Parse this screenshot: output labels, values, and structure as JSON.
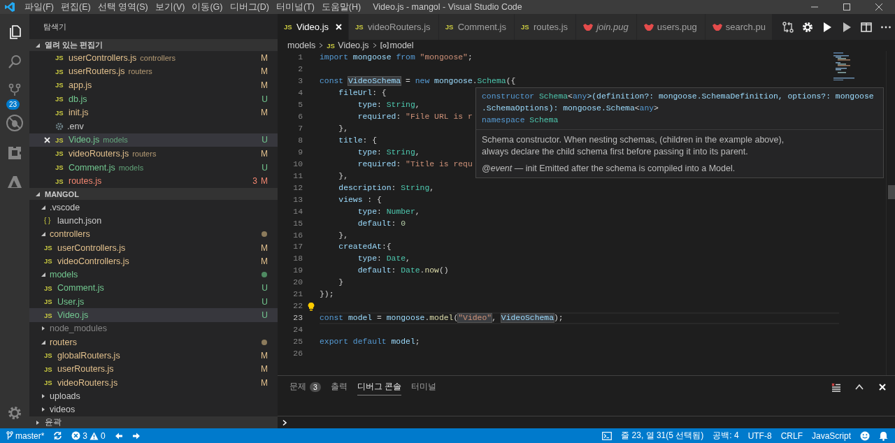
{
  "window": {
    "title": "Video.js - mangol - Visual Studio Code"
  },
  "menu": [
    "파일(F)",
    "편집(E)",
    "선택 영역(S)",
    "보기(V)",
    "이동(G)",
    "디버그(D)",
    "터미널(T)",
    "도움말(H)"
  ],
  "activity_bar": {
    "source_control_badge": "23"
  },
  "sidebar": {
    "title": "탐색기",
    "open_editors": {
      "title": "열려 있는 편집기",
      "expanded": true,
      "items": [
        {
          "name": "userControllers.js",
          "dir": "controllers",
          "kind": "js",
          "icon": "JS",
          "status": "M",
          "selected": false
        },
        {
          "name": "userRouters.js",
          "dir": "routers",
          "kind": "js",
          "icon": "JS",
          "status": "M",
          "selected": false
        },
        {
          "name": "app.js",
          "kind": "js",
          "icon": "JS",
          "status": "M",
          "selected": false
        },
        {
          "name": "db.js",
          "kind": "js",
          "icon": "JS",
          "status": "U",
          "selected": false
        },
        {
          "name": "init.js",
          "kind": "js",
          "icon": "JS",
          "status": "M",
          "selected": false
        },
        {
          "name": ".env",
          "kind": "config",
          "selected": false
        },
        {
          "name": "Video.js",
          "dir": "models",
          "kind": "js",
          "icon": "JS",
          "status": "U",
          "selected": true
        },
        {
          "name": "videoRouters.js",
          "dir": "routers",
          "kind": "js",
          "icon": "JS",
          "status": "M",
          "selected": false
        },
        {
          "name": "Comment.js",
          "dir": "models",
          "kind": "js",
          "icon": "JS",
          "status": "U",
          "selected": false
        },
        {
          "name": "routes.js",
          "kind": "js",
          "icon": "JS",
          "status": "M",
          "problems": "3",
          "selected": false
        }
      ]
    },
    "workspace": {
      "title": "MANGOL",
      "expanded": true,
      "items": [
        {
          "name": ".vscode",
          "kind": "folder",
          "expanded": true,
          "selected": false,
          "children": [
            {
              "name": "launch.json",
              "kind": "json",
              "icon": "{ }",
              "selected": false
            }
          ]
        },
        {
          "name": "controllers",
          "kind": "folder",
          "expanded": true,
          "color": "#8c7b5c",
          "selected": false,
          "children": [
            {
              "name": "userControllers.js",
              "kind": "js",
              "icon": "JS",
              "status": "M",
              "selected": false
            },
            {
              "name": "videoControllers.js",
              "kind": "js",
              "icon": "JS",
              "status": "M",
              "selected": false
            }
          ]
        },
        {
          "name": "models",
          "kind": "folder",
          "expanded": true,
          "color": "#4f8a62",
          "selected": false,
          "children": [
            {
              "name": "Comment.js",
              "kind": "js",
              "icon": "JS",
              "status": "U",
              "selected": false
            },
            {
              "name": "User.js",
              "kind": "js",
              "icon": "JS",
              "status": "U",
              "selected": false
            },
            {
              "name": "Video.js",
              "kind": "js",
              "icon": "JS",
              "status": "U",
              "selected": true
            }
          ]
        },
        {
          "name": "node_modules",
          "kind": "folder",
          "expanded": false,
          "ignored": true,
          "selected": false
        },
        {
          "name": "routers",
          "kind": "folder",
          "expanded": true,
          "color": "#8c7b5c",
          "selected": false,
          "children": [
            {
              "name": "globalRouters.js",
              "kind": "js",
              "icon": "JS",
              "status": "M",
              "selected": false
            },
            {
              "name": "userRouters.js",
              "kind": "js",
              "icon": "JS",
              "status": "M",
              "selected": false
            },
            {
              "name": "videoRouters.js",
              "kind": "js",
              "icon": "JS",
              "status": "M",
              "selected": false
            }
          ]
        },
        {
          "name": "uploads",
          "kind": "folder",
          "expanded": false,
          "selected": false
        },
        {
          "name": "videos",
          "kind": "folder",
          "expanded": false,
          "selected": false
        }
      ]
    },
    "outline": {
      "title": "윤곽",
      "expanded": false
    }
  },
  "editor_tabs": [
    {
      "label": "Video.js",
      "kind": "js",
      "icon": "JS",
      "selected": true,
      "preview": false
    },
    {
      "label": "videoRouters.js",
      "kind": "js",
      "icon": "JS",
      "selected": false,
      "preview": false
    },
    {
      "label": "Comment.js",
      "kind": "js",
      "icon": "JS",
      "selected": false,
      "preview": false
    },
    {
      "label": "routes.js",
      "kind": "js",
      "icon": "JS",
      "selected": false,
      "preview": false
    },
    {
      "label": "join.pug",
      "kind": "pug",
      "selected": false,
      "preview": true
    },
    {
      "label": "users.pug",
      "kind": "pug",
      "selected": false,
      "preview": false
    },
    {
      "label": "search.pu",
      "kind": "pug",
      "selected": false,
      "preview": false
    }
  ],
  "breadcrumbs": [
    {
      "label": "models",
      "kind": "folder"
    },
    {
      "label": "Video.js",
      "kind": "js",
      "icon": "JS"
    },
    {
      "label": "model",
      "kind": "symbol"
    }
  ],
  "code": [
    {
      "number": "1",
      "tokens": [
        {
          "text": "import",
          "kind": "kw"
        },
        {
          "text": " mongoose",
          "kind": "var"
        },
        {
          "text": " from",
          "kind": "kw"
        },
        {
          "text": " \"mongoose\"",
          "kind": "str"
        },
        {
          "text": ";",
          "kind": "p"
        }
      ]
    },
    {
      "number": "2"
    },
    {
      "number": "3",
      "tokens": [
        {
          "text": "const ",
          "kind": "kw"
        },
        {
          "text": "VideoSchema",
          "kind": "var",
          "highlighted": true
        },
        {
          "text": " =",
          "kind": "p"
        },
        {
          "text": " new",
          "kind": "kw"
        },
        {
          "text": " mongoose",
          "kind": "var"
        },
        {
          "text": ".",
          "kind": "p"
        },
        {
          "text": "Schema",
          "kind": "type"
        },
        {
          "text": "({",
          "kind": "p"
        }
      ]
    },
    {
      "number": "4",
      "tokens": [
        {
          "text": "    fileUrl",
          "kind": "prop"
        },
        {
          "text": ": {",
          "kind": "p"
        }
      ]
    },
    {
      "number": "5",
      "tokens": [
        {
          "text": "        type",
          "kind": "prop"
        },
        {
          "text": ":",
          "kind": "p"
        },
        {
          "text": " String",
          "kind": "type"
        },
        {
          "text": ",",
          "kind": "p"
        }
      ]
    },
    {
      "number": "6",
      "tokens": [
        {
          "text": "        required",
          "kind": "prop"
        },
        {
          "text": ":",
          "kind": "p"
        },
        {
          "text": " \"File URL is r",
          "kind": "str"
        }
      ]
    },
    {
      "number": "7",
      "tokens": [
        {
          "text": "    },",
          "kind": "p"
        }
      ]
    },
    {
      "number": "8",
      "tokens": [
        {
          "text": "    title",
          "kind": "prop"
        },
        {
          "text": ": {",
          "kind": "p"
        }
      ]
    },
    {
      "number": "9",
      "tokens": [
        {
          "text": "        type",
          "kind": "prop"
        },
        {
          "text": ":",
          "kind": "p"
        },
        {
          "text": " String",
          "kind": "type"
        },
        {
          "text": ",",
          "kind": "p"
        }
      ]
    },
    {
      "number": "10",
      "tokens": [
        {
          "text": "        required",
          "kind": "prop"
        },
        {
          "text": ":",
          "kind": "p"
        },
        {
          "text": " \"Title is requ",
          "kind": "str"
        }
      ]
    },
    {
      "number": "11",
      "tokens": [
        {
          "text": "    },",
          "kind": "p"
        }
      ]
    },
    {
      "number": "12",
      "tokens": [
        {
          "text": "    description",
          "kind": "prop"
        },
        {
          "text": ":",
          "kind": "p"
        },
        {
          "text": " String",
          "kind": "type"
        },
        {
          "text": ",",
          "kind": "p"
        }
      ]
    },
    {
      "number": "13",
      "tokens": [
        {
          "text": "    views",
          "kind": "prop"
        },
        {
          "text": " : {",
          "kind": "p"
        }
      ]
    },
    {
      "number": "14",
      "tokens": [
        {
          "text": "        type",
          "kind": "prop"
        },
        {
          "text": ":",
          "kind": "p"
        },
        {
          "text": " Number",
          "kind": "type"
        },
        {
          "text": ",",
          "kind": "p"
        }
      ]
    },
    {
      "number": "15",
      "tokens": [
        {
          "text": "        default",
          "kind": "prop"
        },
        {
          "text": ":",
          "kind": "p"
        },
        {
          "text": " 0",
          "kind": "num"
        }
      ]
    },
    {
      "number": "16",
      "tokens": [
        {
          "text": "    },",
          "kind": "p"
        }
      ]
    },
    {
      "number": "17",
      "tokens": [
        {
          "text": "    createdAt",
          "kind": "prop"
        },
        {
          "text": ":{",
          "kind": "p"
        }
      ]
    },
    {
      "number": "18",
      "tokens": [
        {
          "text": "        type",
          "kind": "prop"
        },
        {
          "text": ":",
          "kind": "p"
        },
        {
          "text": " Date",
          "kind": "type"
        },
        {
          "text": ",",
          "kind": "p"
        }
      ]
    },
    {
      "number": "19",
      "tokens": [
        {
          "text": "        default",
          "kind": "prop"
        },
        {
          "text": ":",
          "kind": "p"
        },
        {
          "text": " Date",
          "kind": "type"
        },
        {
          "text": ".",
          "kind": "p"
        },
        {
          "text": "now",
          "kind": "fn"
        },
        {
          "text": "()",
          "kind": "p"
        }
      ]
    },
    {
      "number": "20",
      "tokens": [
        {
          "text": "    }",
          "kind": "p"
        }
      ]
    },
    {
      "number": "21",
      "tokens": [
        {
          "text": "});",
          "kind": "p"
        }
      ]
    },
    {
      "number": "22",
      "lightbulb": true
    },
    {
      "number": "23",
      "tokens": [
        {
          "text": "const",
          "kind": "kw"
        },
        {
          "text": " model",
          "kind": "var"
        },
        {
          "text": " =",
          "kind": "p"
        },
        {
          "text": " mongoose",
          "kind": "var"
        },
        {
          "text": ".",
          "kind": "p"
        },
        {
          "text": "model",
          "kind": "fn"
        },
        {
          "text": "(",
          "kind": "p"
        },
        {
          "text": "\"Video\"",
          "kind": "str",
          "highlighted": true
        },
        {
          "text": ", ",
          "kind": "p"
        },
        {
          "text": "VideoSchema",
          "kind": "var",
          "highlighted": true
        },
        {
          "text": ");",
          "kind": "p"
        }
      ],
      "current": true
    },
    {
      "number": "24"
    },
    {
      "number": "25",
      "tokens": [
        {
          "text": "export",
          "kind": "kw"
        },
        {
          "text": " default",
          "kind": "kw"
        },
        {
          "text": " model",
          "kind": "var"
        },
        {
          "text": ";",
          "kind": "p"
        }
      ]
    },
    {
      "number": "26"
    }
  ],
  "hover": {
    "signature": [
      [
        {
          "text": "constructor",
          "kind": "kw"
        },
        {
          "text": " Schema",
          "kind": "type"
        },
        {
          "text": "<",
          "kind": "p"
        },
        {
          "text": "any",
          "kind": "kw"
        },
        {
          "text": ">(definition?: mongoose.SchemaDefinition, options?: mongoose",
          "kind": "sig"
        }
      ],
      [
        {
          "text": ".SchemaOptions): mongoose.Schema",
          "kind": "sig"
        },
        {
          "text": "<",
          "kind": "p"
        },
        {
          "text": "any",
          "kind": "kw"
        },
        {
          "text": ">",
          "kind": "p"
        }
      ],
      [
        {
          "text": "namespace",
          "kind": "kw"
        },
        {
          "text": " Schema",
          "kind": "type"
        }
      ]
    ],
    "doc": [
      "Schema constructor. When nesting schemas, (children in the example above),",
      "always declare the child schema first before passing it into its parent."
    ],
    "tag": "*@event* — init Emitted after the schema is compiled into a Model."
  },
  "panel": {
    "tabs": [
      {
        "label": "문제",
        "badge": "3",
        "selected": false
      },
      {
        "label": "출력",
        "selected": false
      },
      {
        "label": "디버그 콘솔",
        "selected": true
      },
      {
        "label": "터미널",
        "selected": false
      }
    ]
  },
  "status_bar": {
    "branch": "master*",
    "errors": "3",
    "warnings": "0",
    "position": "줄 23, 열 31(5 선택됨)",
    "indent": "공백: 4",
    "encoding": "UTF-8",
    "eol": "CRLF",
    "language": "JavaScript"
  }
}
